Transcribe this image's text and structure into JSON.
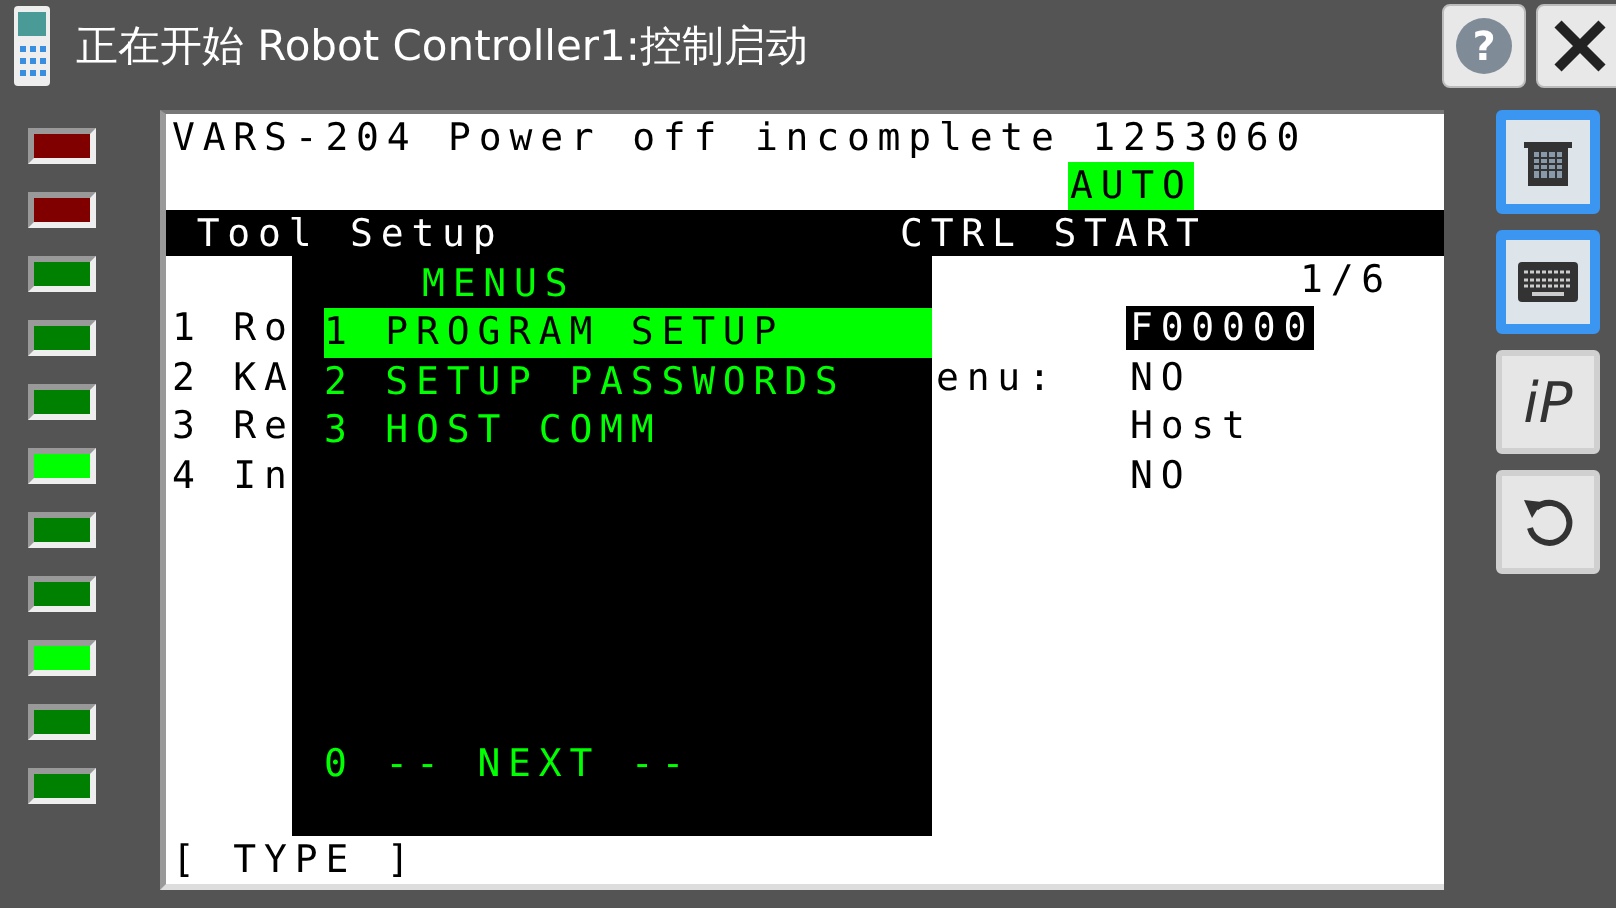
{
  "window": {
    "title": "正在开始 Robot Controller1:控制启动",
    "help_button": {
      "label": "?"
    }
  },
  "indicators": [
    {
      "color": "#800000"
    },
    {
      "color": "#800000"
    },
    {
      "color": "#008000"
    },
    {
      "color": "#008000"
    },
    {
      "color": "#008000"
    },
    {
      "color": "#00ff00"
    },
    {
      "color": "#008000"
    },
    {
      "color": "#008000"
    },
    {
      "color": "#00ff00"
    },
    {
      "color": "#008000"
    },
    {
      "color": "#008000"
    }
  ],
  "screen": {
    "alarm": "VARS-204 Power off incomplete 1253060",
    "mode": "AUTO",
    "title": "Tool Setup",
    "status": "CTRL START",
    "page": "1/6",
    "rows": [
      {
        "label": "1 Ro",
        "value": "F00000",
        "selected": true
      },
      {
        "label": "2 KA",
        "tail": "enu:",
        "value": "NO",
        "selected": false
      },
      {
        "label": "3 Re",
        "value": "Host",
        "selected": false
      },
      {
        "label": "4 In",
        "value": "NO",
        "selected": false
      }
    ],
    "function_keys": "[ TYPE ]",
    "menu": {
      "title": "MENUS",
      "items": [
        {
          "label": "1 PROGRAM SETUP",
          "selected": true
        },
        {
          "label": "2 SETUP PASSWORDS",
          "selected": false
        },
        {
          "label": "3 HOST COMM",
          "selected": false
        }
      ],
      "next": "0 -- NEXT --"
    }
  },
  "tools": [
    {
      "kind": "pendant",
      "on": true
    },
    {
      "kind": "keyboard",
      "on": true
    },
    {
      "kind": "text",
      "label": "iP",
      "on": false
    },
    {
      "kind": "refresh",
      "on": false
    }
  ]
}
